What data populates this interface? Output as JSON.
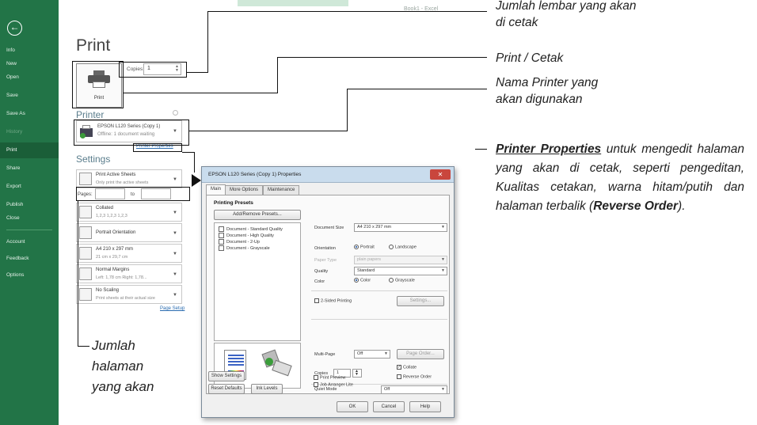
{
  "window": {
    "excel_title": "Book1 - Excel"
  },
  "sidebar": {
    "items": [
      {
        "label": "Info"
      },
      {
        "label": "New"
      },
      {
        "label": "Open"
      },
      {
        "label": "Save"
      },
      {
        "label": "Save As"
      },
      {
        "label": "History"
      },
      {
        "label": "Print"
      },
      {
        "label": "Share"
      },
      {
        "label": "Export"
      },
      {
        "label": "Publish"
      },
      {
        "label": "Close"
      },
      {
        "label": "Account"
      },
      {
        "label": "Feedback"
      },
      {
        "label": "Options"
      }
    ],
    "active": "Print"
  },
  "print_panel": {
    "heading": "Print",
    "print_button_label": "Print",
    "copies_label": "Copies:",
    "copies_value": "1",
    "printer_heading": "Printer",
    "printer_name": "EPSON L120 Series (Copy 1)",
    "printer_status": "Offline: 1 document waiting",
    "printer_properties_link": "Printer Properties",
    "settings_heading": "Settings",
    "settings": [
      {
        "main": "Print Active Sheets",
        "sub": "Only print the active sheets"
      },
      {
        "main": "Collated",
        "sub": "1,2,3   1,2,3   1,2,3"
      },
      {
        "main": "Portrait Orientation",
        "sub": ""
      },
      {
        "main": "A4 210 x 297 mm",
        "sub": "21 cm x 29,7 cm"
      },
      {
        "main": "Normal Margins",
        "sub": "Left: 1,78 cm   Right: 1,78..."
      },
      {
        "main": "No Scaling",
        "sub": "Print sheets at their actual size"
      }
    ],
    "pages_label": "Pages:",
    "pages_to_label": "to",
    "page_setup_link": "Page Setup"
  },
  "dialog": {
    "title": "EPSON L120 Series (Copy 1) Properties",
    "close_glyph": "✕",
    "tabs": [
      "Main",
      "More Options",
      "Maintenance"
    ],
    "presets_heading": "Printing Presets",
    "add_remove_presets": "Add/Remove Presets...",
    "presets": [
      "Document - Standard Quality",
      "Document - High Quality",
      "Document - 2-Up",
      "Document - Grayscale"
    ],
    "document_size_label": "Document Size",
    "document_size_value": "A4 210 x 297 mm",
    "orientation_label": "Orientation",
    "portrait": "Portrait",
    "landscape": "Landscape",
    "paper_type_label": "Paper Type",
    "paper_type_value": "plain papers",
    "quality_label": "Quality",
    "quality_value": "Standard",
    "color_label": "Color",
    "color_value": "Color",
    "grayscale": "Grayscale",
    "two_sided": "2-Sided Printing",
    "settings_button": "Settings...",
    "multipage_label": "Multi-Page",
    "multipage_value": "Off",
    "page_order_button": "Page Order...",
    "copies_label": "Copies",
    "copies_value": "1",
    "collate": "Collate",
    "reverse_order": "Reverse Order",
    "quiet_mode_label": "Quiet Mode",
    "quiet_mode_value": "Off",
    "print_preview": "Print Preview",
    "job_arranger": "Job Arranger Lite",
    "show_settings": "Show Settings",
    "reset_defaults": "Reset Defaults",
    "ink_levels": "Ink Levels",
    "ok": "OK",
    "cancel": "Cancel",
    "help": "Help"
  },
  "annotations": {
    "copies_1": "Jumlah lembar yang akan",
    "copies_2": "di cetak",
    "print": "Print / Cetak",
    "printer_1": "Nama Printer yang",
    "printer_2": "akan digunakan",
    "props_bold": "Printer Properties",
    "props_rest": "untuk mengedit halaman yang akan di cetak, seperti pengeditan, Kualitas cetakan, warna hitam/putih dan halaman terbalik (",
    "props_bold2": "Reverse Order",
    "props_end": ").",
    "pages_1": "Jumlah",
    "pages_2": "halaman",
    "pages_3": "yang akan"
  },
  "colors": {
    "sidebar": "#227447",
    "accent": "#1a5e38",
    "link": "#2a6cb0"
  }
}
